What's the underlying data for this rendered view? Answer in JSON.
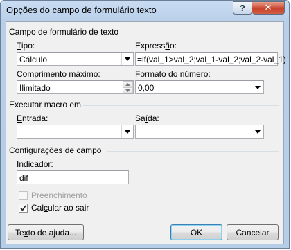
{
  "window": {
    "title": "Opções do campo de formulário texto",
    "help_glyph": "?",
    "close_glyph": "✕"
  },
  "section_text_field": {
    "title": "Campo de formulário de texto",
    "type": {
      "label_key": "T",
      "label_rest": "ipo:",
      "value": "Cálculo"
    },
    "expression": {
      "label_pre": "Express",
      "label_key": "ã",
      "label_post": "o:",
      "value": "=if(val_1>val_2;val_1-val_2;val_2-val_1)"
    },
    "max_length": {
      "label_key": "C",
      "label_rest": "omprimento máximo:",
      "value": "Ilimitado"
    },
    "number_format": {
      "label_key": "F",
      "label_rest": "ormato do número:",
      "value": "0,00"
    }
  },
  "section_macro": {
    "title": "Executar macro em",
    "entry": {
      "label_key": "E",
      "label_rest": "ntrada:",
      "value": ""
    },
    "exit": {
      "label_pre": "Sa",
      "label_key": "í",
      "label_post": "da:",
      "value": ""
    }
  },
  "section_settings": {
    "title": "Configurações de campo",
    "bookmark": {
      "label_key": "I",
      "label_rest": "ndicador:",
      "value": "dif"
    },
    "fill_in": {
      "label": "Preenchimento",
      "checked": false,
      "enabled": false
    },
    "calc_on_exit": {
      "label_pre": "Cal",
      "label_key": "c",
      "label_post": "ular ao sair",
      "checked": true,
      "enabled": true
    }
  },
  "buttons": {
    "help_text": {
      "label_pre": "Te",
      "label_key": "x",
      "label_post": "to de ajuda..."
    },
    "ok": "OK",
    "cancel": "Cancelar"
  }
}
